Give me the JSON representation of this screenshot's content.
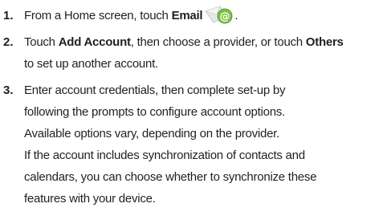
{
  "steps": [
    {
      "number": "1.",
      "lines": [
        {
          "pre": "From a Home screen, touch ",
          "bold": "Email",
          "post": "."
        }
      ],
      "icon": "email-app-icon"
    },
    {
      "number": "2.",
      "lines": [
        {
          "pre": "Touch ",
          "bold": "Add Account",
          "mid": ", then choose a provider, or touch ",
          "bold2": "Others"
        },
        {
          "text": "to set up another account."
        }
      ]
    },
    {
      "number": "3.",
      "lines": [
        {
          "text": "Enter account credentials, then complete set-up by"
        },
        {
          "text": "following the prompts to configure account options."
        },
        {
          "text": "Available options vary, depending on the provider."
        },
        {
          "text": "If the account includes synchronization of contacts and"
        },
        {
          "text": "calendars, you can choose whether to synchronize these"
        },
        {
          "text": "features with your device."
        }
      ]
    }
  ],
  "colors": {
    "text": "#231f20",
    "icon_green": "#7cc242",
    "icon_envelope": "#e8e8e8"
  }
}
